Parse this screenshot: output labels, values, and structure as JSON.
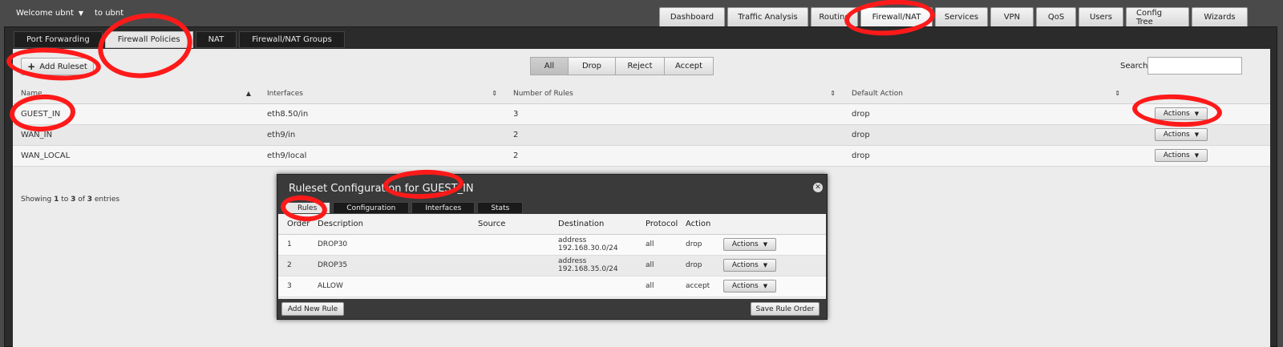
{
  "topbar": {
    "welcome": "Welcome ubnt",
    "to": "to ubnt",
    "nav": [
      "Dashboard",
      "Traffic Analysis",
      "Routing",
      "Firewall/NAT",
      "Services",
      "VPN",
      "QoS",
      "Users",
      "Config Tree",
      "Wizards"
    ],
    "active_nav": "Firewall/NAT"
  },
  "subtabs": [
    "Port Forwarding",
    "Firewall Policies",
    "NAT",
    "Firewall/NAT Groups"
  ],
  "toolbar": {
    "add_ruleset": "Add Ruleset",
    "filters": [
      "All",
      "Drop",
      "Reject",
      "Accept"
    ],
    "active_filter": "All",
    "search_label": "Search",
    "search_value": ""
  },
  "list": {
    "headers": [
      "Name",
      "Interfaces",
      "Number of Rules",
      "Default Action"
    ],
    "rows": [
      {
        "name": "GUEST_IN",
        "interfaces": "eth8.50/in",
        "rules": "3",
        "action": "drop",
        "btn": "Actions"
      },
      {
        "name": "WAN_IN",
        "interfaces": "eth9/in",
        "rules": "2",
        "action": "drop",
        "btn": "Actions"
      },
      {
        "name": "WAN_LOCAL",
        "interfaces": "eth9/local",
        "rules": "2",
        "action": "drop",
        "btn": "Actions"
      }
    ],
    "showing_pre": "Showing ",
    "showing_from": "1",
    "showing_mid1": " to ",
    "showing_to": "3",
    "showing_mid2": " of ",
    "showing_total": "3",
    "showing_post": " entries"
  },
  "modal": {
    "title": "Ruleset Configuration for GUEST_IN",
    "tabs": [
      "Rules",
      "Configuration",
      "Interfaces",
      "Stats"
    ],
    "headers": [
      "Order",
      "Description",
      "Source",
      "Destination",
      "Protocol",
      "Action"
    ],
    "rows": [
      {
        "order": "1",
        "desc": "DROP30",
        "source": "",
        "dest": "address 192.168.30.0/24",
        "proto": "all",
        "action": "drop",
        "btn": "Actions"
      },
      {
        "order": "2",
        "desc": "DROP35",
        "source": "",
        "dest": "address 192.168.35.0/24",
        "proto": "all",
        "action": "drop",
        "btn": "Actions"
      },
      {
        "order": "3",
        "desc": "ALLOW",
        "source": "",
        "dest": "",
        "proto": "all",
        "action": "accept",
        "btn": "Actions"
      }
    ],
    "add_rule": "Add New Rule",
    "save_order": "Save Rule Order"
  },
  "colors": {
    "annotation": "#ff1a1a",
    "background": "#4a4a4a"
  }
}
